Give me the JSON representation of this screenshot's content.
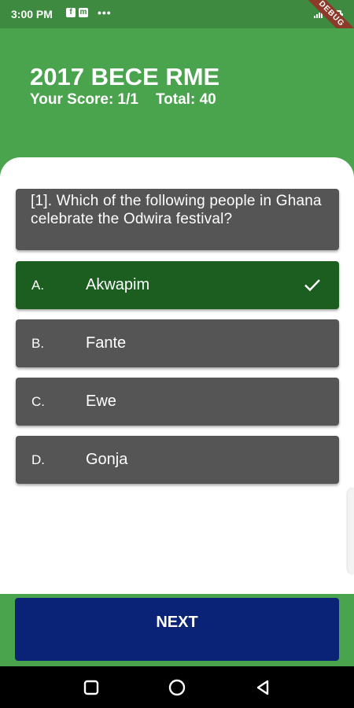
{
  "status_bar": {
    "time": "3:00 PM",
    "left_icons": [
      "facebook-icon",
      "messenger-icon"
    ],
    "more": "•••",
    "right_icons": [
      "signal-icon",
      "battery-icon"
    ]
  },
  "debug_banner": "DEBUG",
  "header": {
    "title": "2017 BECE RME",
    "score_label": "Your Score: 1/1",
    "total_label": "Total: 40"
  },
  "question": {
    "text": "[1]. Which of the following people in Ghana celebrate the Odwira festival?"
  },
  "options": [
    {
      "letter": "A.",
      "text": "Akwapim",
      "state": "correct"
    },
    {
      "letter": "B.",
      "text": "Fante",
      "state": "default"
    },
    {
      "letter": "C.",
      "text": "Ewe",
      "state": "default"
    },
    {
      "letter": "D.",
      "text": "Gonja",
      "state": "default"
    }
  ],
  "next_button": {
    "label": "NEXT"
  },
  "colors": {
    "header_green": "#4aa34d",
    "correct_green": "#1b5e20",
    "option_gray": "#555555",
    "next_blue": "#0b2376"
  },
  "nav_bar": [
    "recents-icon",
    "home-icon",
    "back-icon"
  ]
}
